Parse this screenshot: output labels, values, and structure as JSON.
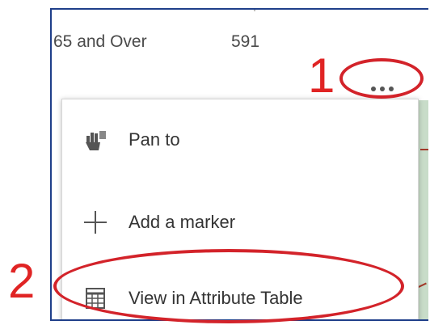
{
  "popup": {
    "row": {
      "field": "65 and Over",
      "value": "591"
    },
    "more_actions": {
      "icon": "more-horizontal-icon"
    }
  },
  "menu": {
    "items": [
      {
        "label": "Pan to",
        "icon": "pan-hand-icon"
      },
      {
        "label": "Add a marker",
        "icon": "plus-icon"
      },
      {
        "label": "View in Attribute Table",
        "icon": "table-icon"
      }
    ]
  },
  "annotations": {
    "step1": "1",
    "step2": "2",
    "color": "#e02424"
  },
  "colors": {
    "frame_border": "#1f3f8a",
    "annotation_ring": "#d3232a",
    "map_fill": "#c8dcc9"
  }
}
